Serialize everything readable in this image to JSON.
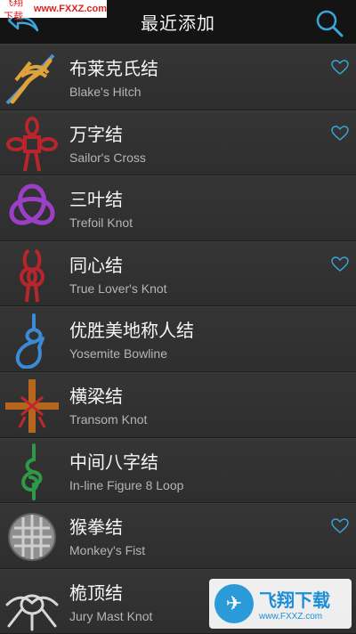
{
  "watermark": {
    "top_label": "飞翔下载",
    "top_url": "www.FXXZ.com",
    "bottom_name": "飞翔下载",
    "bottom_url": "www.FXXZ.com"
  },
  "navbar": {
    "title": "最近添加",
    "back_icon": "back-arrow-icon",
    "search_icon": "search-icon"
  },
  "colors": {
    "accent": "#3aa6d8",
    "background": "#2b2b2b",
    "navbar": "#141414"
  },
  "knots": [
    {
      "cn": "布莱克氏结",
      "en": "Blake's Hitch",
      "favorite": true
    },
    {
      "cn": "万字结",
      "en": "Sailor's Cross",
      "favorite": true
    },
    {
      "cn": "三叶结",
      "en": "Trefoil Knot",
      "favorite": false
    },
    {
      "cn": "同心结",
      "en": "True Lover's Knot",
      "favorite": true
    },
    {
      "cn": "优胜美地称人结",
      "en": "Yosemite Bowline",
      "favorite": false
    },
    {
      "cn": "横梁结",
      "en": "Transom Knot",
      "favorite": false
    },
    {
      "cn": "中间八字结",
      "en": "In-line Figure 8 Loop",
      "favorite": false
    },
    {
      "cn": "猴拳结",
      "en": "Monkey's Fist",
      "favorite": true
    },
    {
      "cn": "桅顶结",
      "en": "Jury Mast Knot",
      "favorite": false
    }
  ]
}
